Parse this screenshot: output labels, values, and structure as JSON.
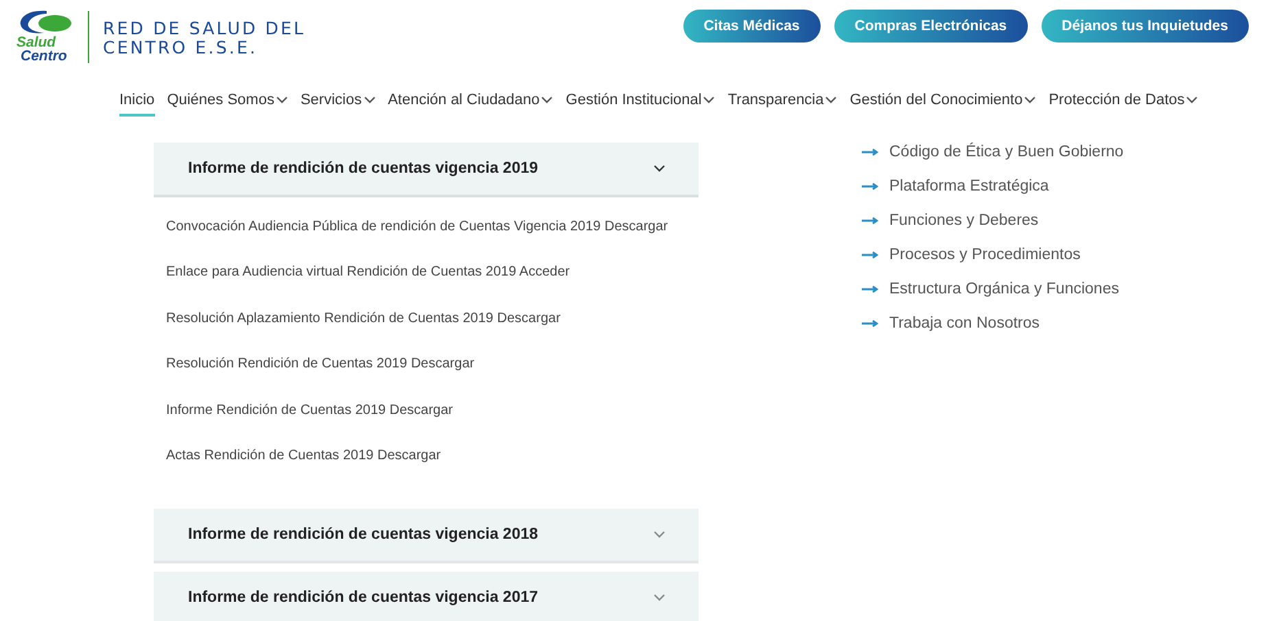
{
  "logo": {
    "line_1": "Salud",
    "line_2": "Centro"
  },
  "org_name": [
    "RED DE SALUD DEL",
    "CENTRO E.S.E."
  ],
  "top_buttons": [
    "Citas Médicas",
    "Compras Electrónicas",
    "Déjanos tus Inquietudes"
  ],
  "nav": [
    {
      "label": "Inicio",
      "selected": true,
      "dropdown": false
    },
    {
      "label": "Quiénes Somos",
      "selected": false,
      "dropdown": true
    },
    {
      "label": "Servicios",
      "selected": false,
      "dropdown": true
    },
    {
      "label": "Atención al Ciudadano",
      "selected": false,
      "dropdown": true
    },
    {
      "label": "Gestión Institucional",
      "selected": false,
      "dropdown": true
    },
    {
      "label": "Transparencia",
      "selected": false,
      "dropdown": true
    },
    {
      "label": "Gestión del Conocimiento",
      "selected": false,
      "dropdown": true
    },
    {
      "label": "Protección de Datos",
      "selected": false,
      "dropdown": true
    }
  ],
  "accordion": [
    {
      "title": "Informe de rendición de cuentas vigencia 2019",
      "expanded": true,
      "items": [
        "Convocación Audiencia Pública de rendición de Cuentas Vigencia 2019 Descargar",
        "Enlace para Audiencia virtual Rendición de Cuentas 2019 Acceder",
        "Resolución Aplazamiento Rendición de Cuentas 2019 Descargar",
        "Resolución Rendición de Cuentas 2019 Descargar",
        "Informe Rendición de Cuentas 2019 Descargar",
        "Actas Rendición de Cuentas 2019 Descargar"
      ]
    },
    {
      "title": "Informe de rendición de cuentas vigencia 2018",
      "expanded": false
    },
    {
      "title": "Informe de rendición de cuentas vigencia 2017",
      "expanded": false
    }
  ],
  "links": [
    "Código de Ética y Buen Gobierno",
    "Plataforma Estratégica",
    "Funciones y Deberes",
    "Procesos y Procedimientos",
    "Estructura Orgánica y Funciones",
    "Trabaja con Nosotros"
  ]
}
